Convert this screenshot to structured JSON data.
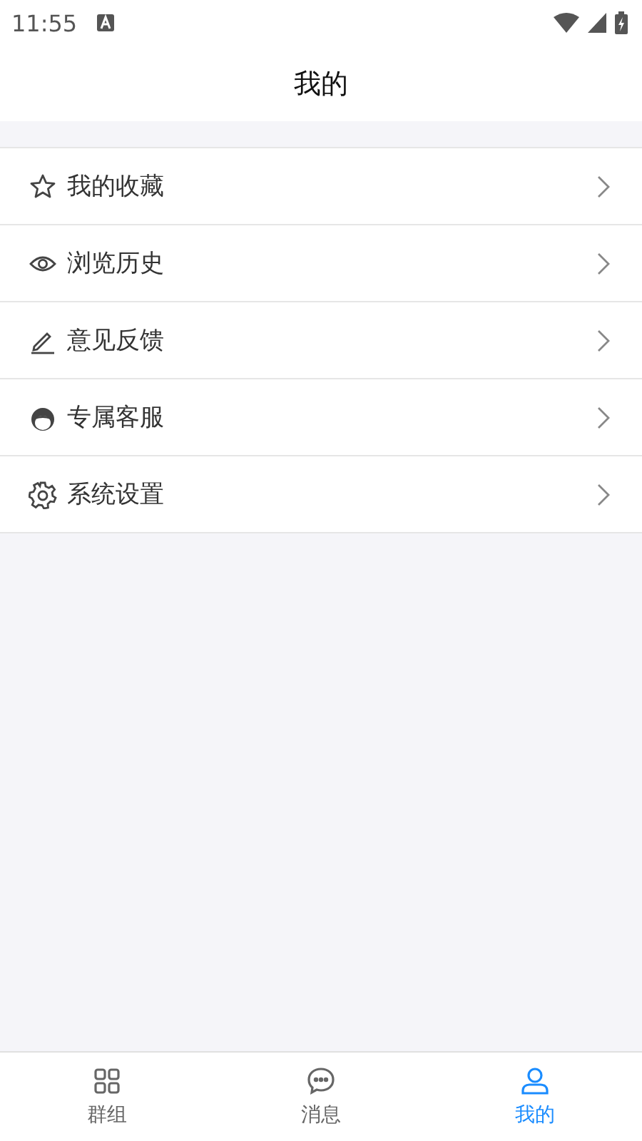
{
  "status_bar": {
    "time": "11:55"
  },
  "header": {
    "title": "我的"
  },
  "menu": [
    {
      "kind": "star",
      "label": "我的收藏"
    },
    {
      "kind": "eye",
      "label": "浏览历史"
    },
    {
      "kind": "pencil",
      "label": "意见反馈"
    },
    {
      "kind": "avatar",
      "label": "专属客服"
    },
    {
      "kind": "gear",
      "label": "系统设置"
    }
  ],
  "tabs": [
    {
      "kind": "grid",
      "label": "群组",
      "selected": false
    },
    {
      "kind": "chat",
      "label": "消息",
      "selected": false
    },
    {
      "kind": "person",
      "label": "我的",
      "selected": true
    }
  ]
}
